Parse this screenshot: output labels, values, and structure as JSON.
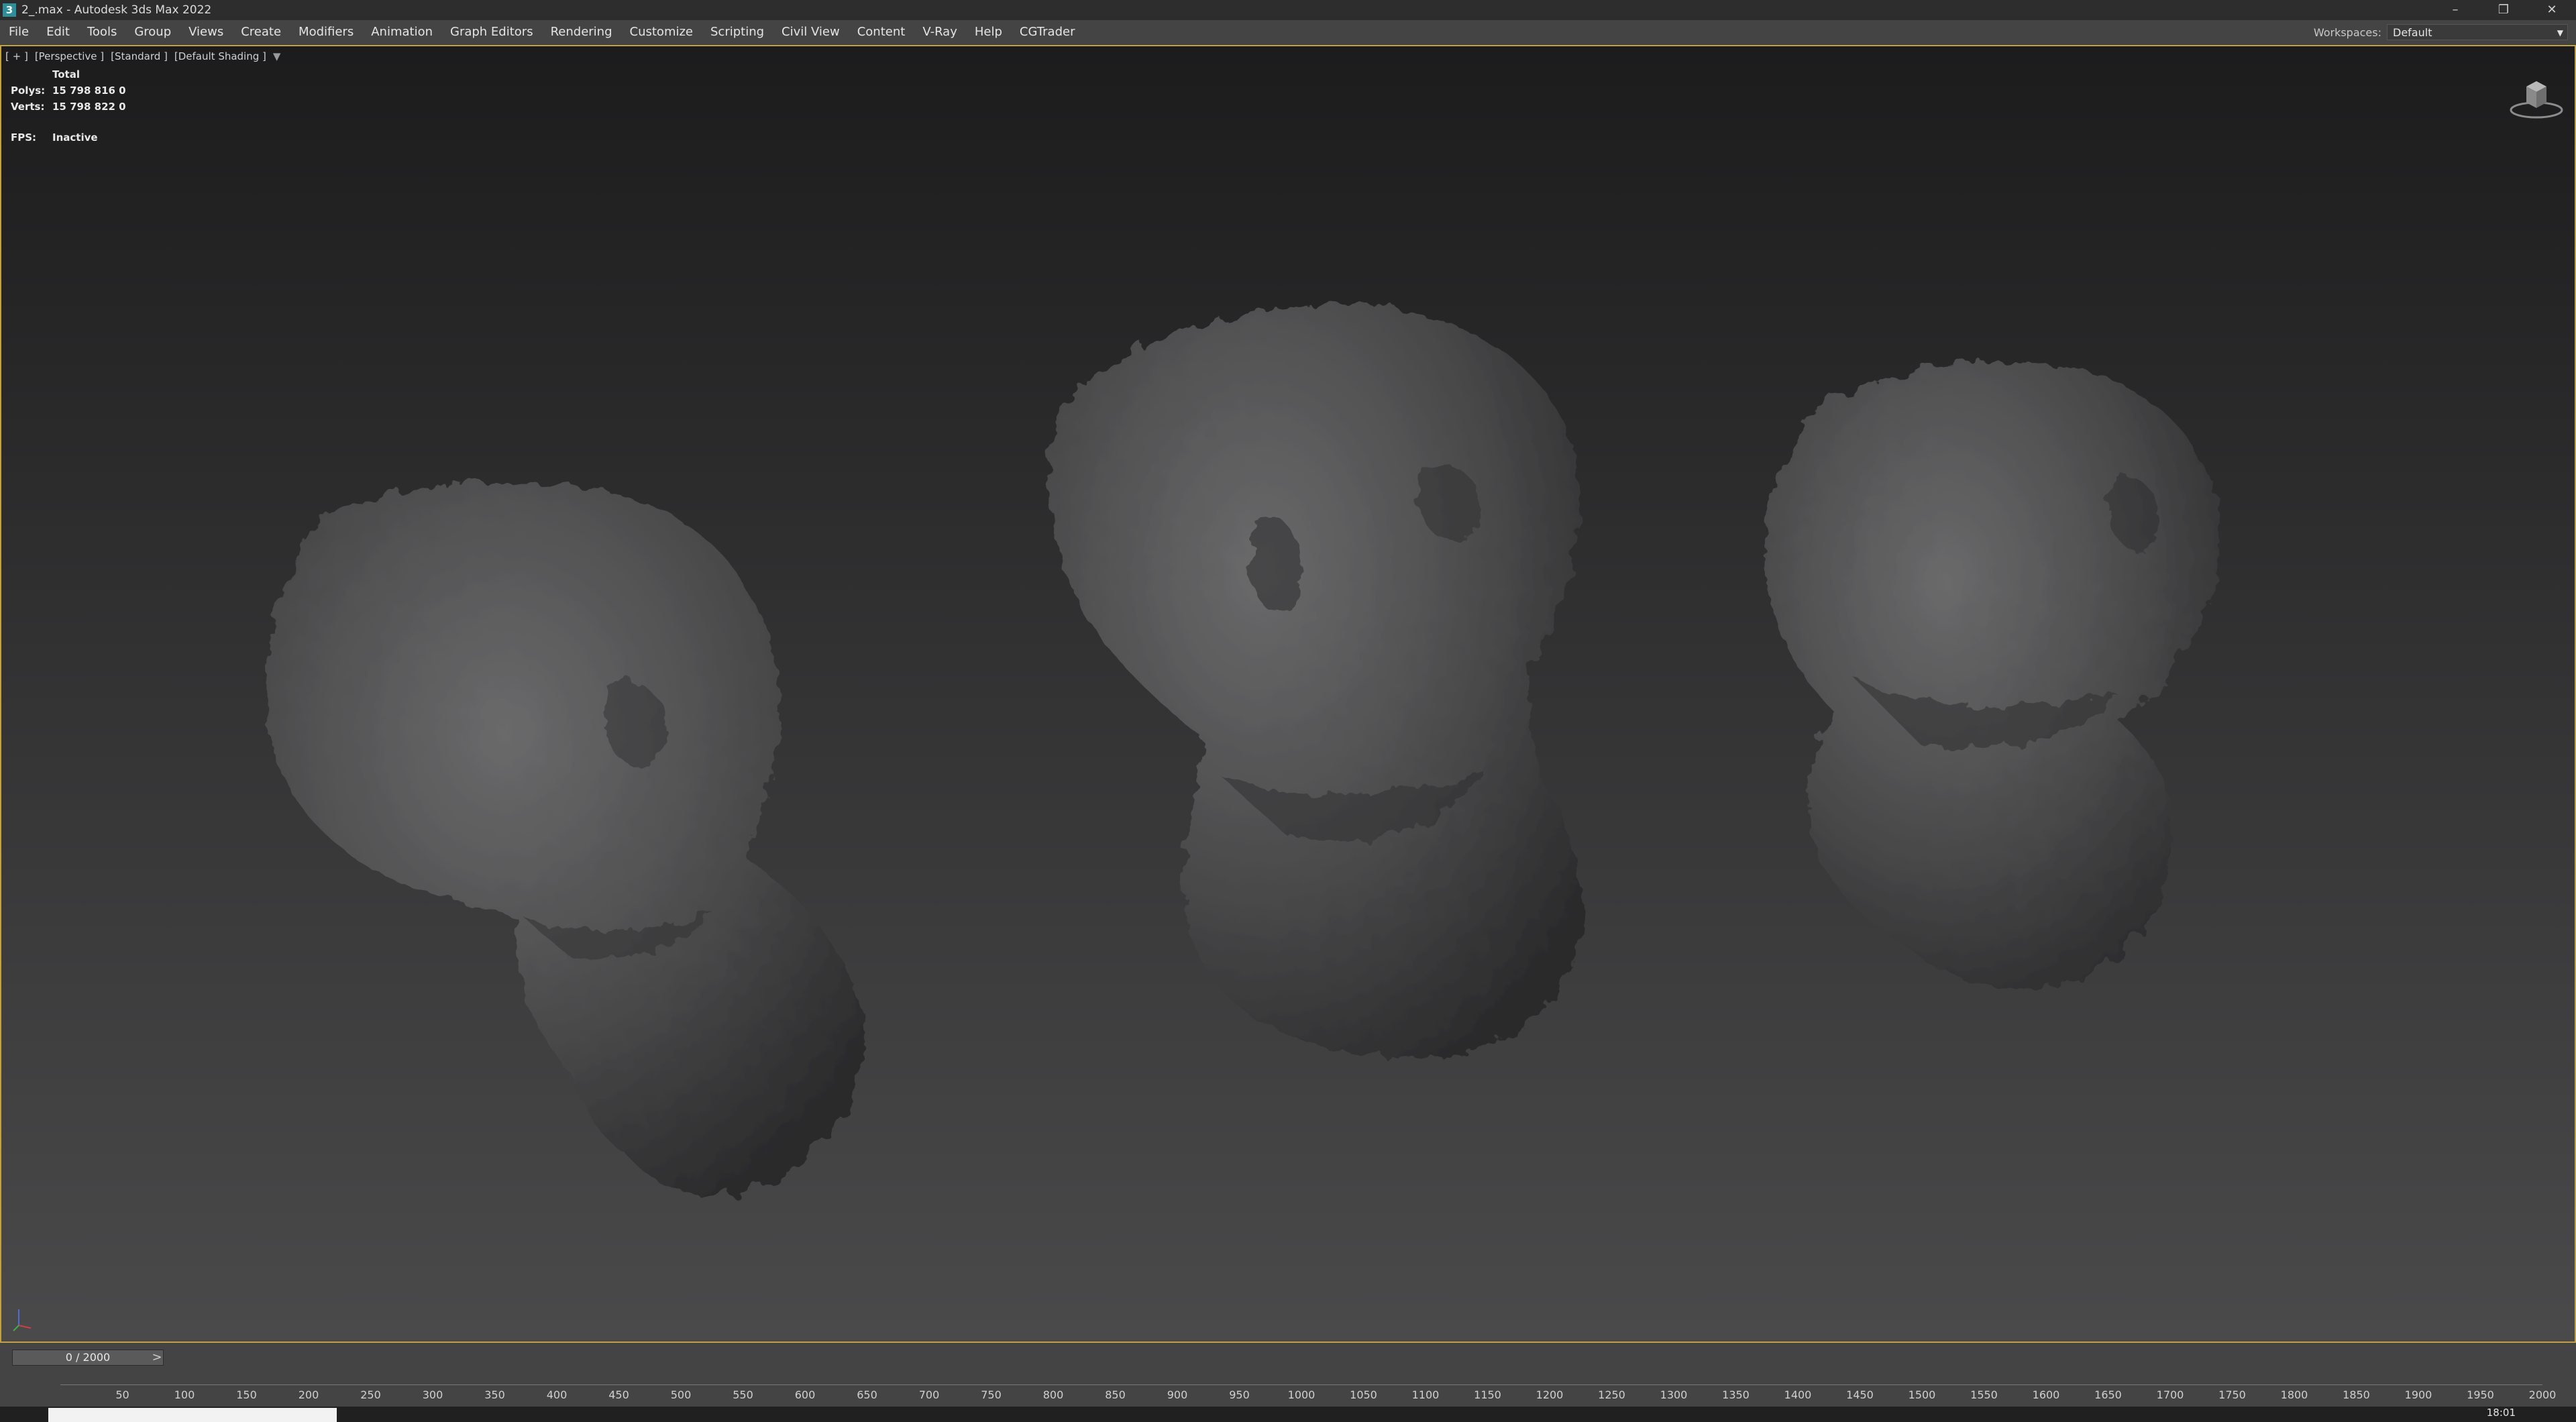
{
  "window": {
    "app_icon": "3",
    "title": "2_.max - Autodesk 3ds Max 2022",
    "minimize_icon": "minimize-icon",
    "restore_icon": "restore-icon",
    "close_icon": "close-icon"
  },
  "menu": {
    "items": [
      "File",
      "Edit",
      "Tools",
      "Group",
      "Views",
      "Create",
      "Modifiers",
      "Animation",
      "Graph Editors",
      "Rendering",
      "Customize",
      "Scripting",
      "Civil View",
      "Content",
      "V-Ray",
      "Help",
      "CGTrader"
    ],
    "workspaces_label": "Workspaces:",
    "workspace_value": "Default"
  },
  "viewport": {
    "label_plus": "[ + ]",
    "label_view": "[Perspective ]",
    "label_standard": "[Standard ]",
    "label_shading": "[Default Shading ]",
    "stats_header": "Total",
    "polys_label": "Polys:",
    "polys_value": "15 798 816 0",
    "verts_label": "Verts:",
    "verts_value": "15 798 822 0",
    "fps_label": "FPS:",
    "fps_value": "Inactive"
  },
  "timeline": {
    "frame_display": "0 / 2000",
    "prev": "<",
    "next": ">",
    "ticks": [
      "50",
      "100",
      "150",
      "200",
      "250",
      "300",
      "350",
      "400",
      "450",
      "500",
      "550",
      "600",
      "650",
      "700",
      "750",
      "800",
      "850",
      "900",
      "950",
      "1000",
      "1050",
      "1100",
      "1150",
      "1200",
      "1250",
      "1300",
      "1350",
      "1400",
      "1450",
      "1500",
      "1550",
      "1600",
      "1650",
      "1700",
      "1750",
      "1800",
      "1850",
      "1900",
      "1950",
      "2000"
    ]
  },
  "taskbar": {
    "clock": "18:01"
  },
  "colors": {
    "viewport_border": "#c2a23a",
    "menubar": "#444444",
    "titlebar": "#2d2d2d",
    "rock": "#4b4b4c"
  }
}
